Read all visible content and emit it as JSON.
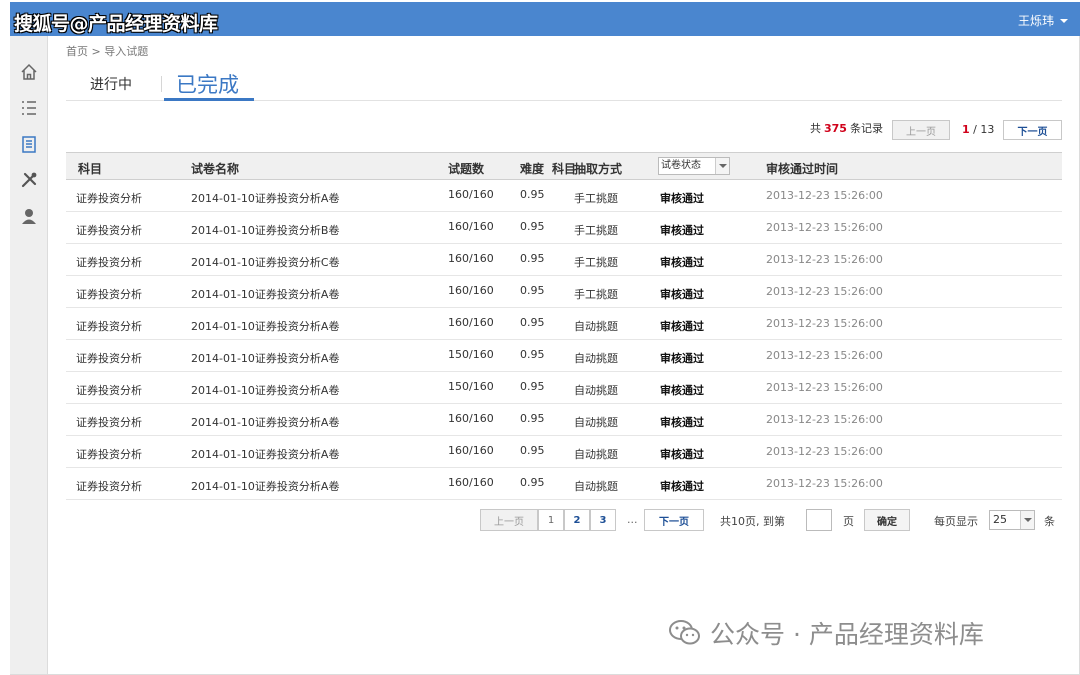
{
  "watermark_top": "搜狐号@产品经理资料库",
  "user_name": "王烁玮",
  "breadcrumb": "首页 > 导入试题",
  "tabs": {
    "in_progress": "进行中",
    "completed": "已完成"
  },
  "pager_top": {
    "prefix": "共",
    "total": "375",
    "suffix": "条记录",
    "prev": "上一页",
    "current": "1",
    "total_pages": "/ 13",
    "next": "下一页"
  },
  "columns": [
    "科目",
    "试卷名称",
    "试题数",
    "难度",
    "科目",
    "抽取方式",
    "审核通过时间"
  ],
  "status_filter": "试卷状态",
  "rows": [
    {
      "subject": "证券投资分析",
      "name": "2014-01-10证券投资分析A卷",
      "count": "160/160",
      "difficulty": "0.95",
      "method": "手工挑题",
      "status": "审核通过",
      "time": "2013-12-23 15:26:00"
    },
    {
      "subject": "证券投资分析",
      "name": "2014-01-10证券投资分析B卷",
      "count": "160/160",
      "difficulty": "0.95",
      "method": "手工挑题",
      "status": "审核通过",
      "time": "2013-12-23 15:26:00"
    },
    {
      "subject": "证券投资分析",
      "name": "2014-01-10证券投资分析C卷",
      "count": "160/160",
      "difficulty": "0.95",
      "method": "手工挑题",
      "status": "审核通过",
      "time": "2013-12-23 15:26:00"
    },
    {
      "subject": "证券投资分析",
      "name": "2014-01-10证券投资分析A卷",
      "count": "160/160",
      "difficulty": "0.95",
      "method": "手工挑题",
      "status": "审核通过",
      "time": "2013-12-23 15:26:00"
    },
    {
      "subject": "证券投资分析",
      "name": "2014-01-10证券投资分析A卷",
      "count": "160/160",
      "difficulty": "0.95",
      "method": "自动挑题",
      "status": "审核通过",
      "time": "2013-12-23 15:26:00"
    },
    {
      "subject": "证券投资分析",
      "name": "2014-01-10证券投资分析A卷",
      "count": "150/160",
      "difficulty": "0.95",
      "method": "自动挑题",
      "status": "审核通过",
      "time": "2013-12-23 15:26:00"
    },
    {
      "subject": "证券投资分析",
      "name": "2014-01-10证券投资分析A卷",
      "count": "150/160",
      "difficulty": "0.95",
      "method": "自动挑题",
      "status": "审核通过",
      "time": "2013-12-23 15:26:00"
    },
    {
      "subject": "证券投资分析",
      "name": "2014-01-10证券投资分析A卷",
      "count": "160/160",
      "difficulty": "0.95",
      "method": "自动挑题",
      "status": "审核通过",
      "time": "2013-12-23 15:26:00"
    },
    {
      "subject": "证券投资分析",
      "name": "2014-01-10证券投资分析A卷",
      "count": "160/160",
      "difficulty": "0.95",
      "method": "自动挑题",
      "status": "审核通过",
      "time": "2013-12-23 15:26:00"
    },
    {
      "subject": "证券投资分析",
      "name": "2014-01-10证券投资分析A卷",
      "count": "160/160",
      "difficulty": "0.95",
      "method": "自动挑题",
      "status": "审核通过",
      "time": "2013-12-23 15:26:00"
    }
  ],
  "pager_bottom": {
    "prev": "上一页",
    "pages": [
      "1",
      "2",
      "3"
    ],
    "ellipsis": "...",
    "next": "下一页",
    "total_pages_text": "共10页, 到第",
    "page_unit": "页",
    "confirm": "确定",
    "per_page_label": "每页显示",
    "per_page_value": "25",
    "per_page_unit": "条"
  },
  "watermark_bottom": "公众号 · 产品经理资料库",
  "colors": {
    "header": "#4a86cf",
    "accent": "#3b78c4",
    "highlight": "#d0021b"
  },
  "sidebar_icons": [
    "home-icon",
    "list-icon",
    "paper-icon",
    "tools-icon",
    "user-icon"
  ]
}
